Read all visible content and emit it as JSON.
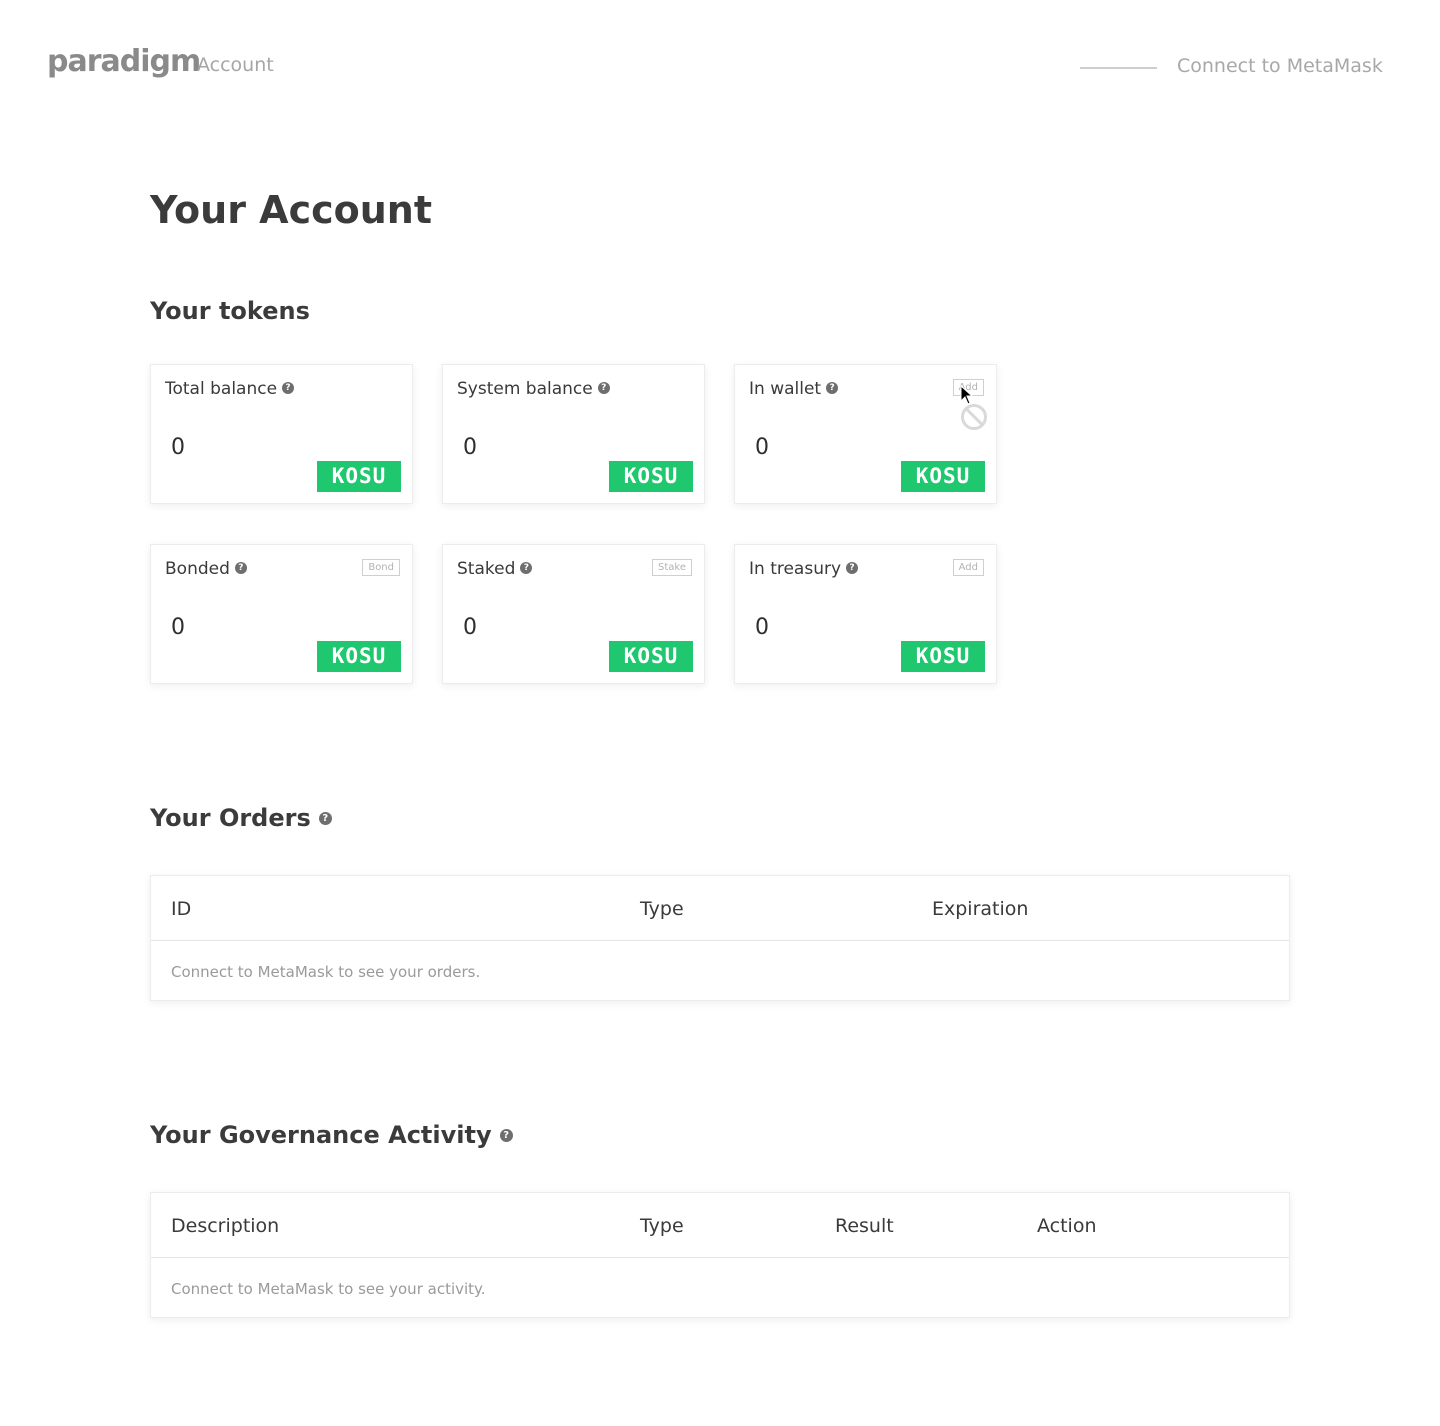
{
  "header": {
    "logo": "paradigm",
    "logo_sub": "Account",
    "connect_label": "Connect to MetaMask"
  },
  "page": {
    "title": "Your Account"
  },
  "tokens": {
    "title": "Your tokens",
    "help_glyph": "?",
    "cards": [
      {
        "label": "Total balance",
        "value": "0",
        "unit": "KOSU",
        "action": ""
      },
      {
        "label": "System balance",
        "value": "0",
        "unit": "KOSU",
        "action": ""
      },
      {
        "label": "In wallet",
        "value": "0",
        "unit": "KOSU",
        "action": "Add"
      },
      {
        "label": "Bonded",
        "value": "0",
        "unit": "KOSU",
        "action": "Bond"
      },
      {
        "label": "Staked",
        "value": "0",
        "unit": "KOSU",
        "action": "Stake"
      },
      {
        "label": "In treasury",
        "value": "0",
        "unit": "KOSU",
        "action": "Add"
      }
    ]
  },
  "orders": {
    "title": "Your Orders",
    "columns": [
      "ID",
      "Type",
      "Expiration"
    ],
    "empty_text": "Connect to MetaMask to see your orders."
  },
  "governance": {
    "title": "Your Governance Activity",
    "columns": [
      "Description",
      "Type",
      "Result",
      "Action"
    ],
    "empty_text": "Connect to MetaMask to see your activity."
  },
  "colors": {
    "accent_green": "#1fc76f",
    "text_dark": "#3a3a3a",
    "muted": "#a8a8a8"
  },
  "icons": [
    "help-icon",
    "cursor-arrow-icon",
    "not-allowed-icon"
  ]
}
